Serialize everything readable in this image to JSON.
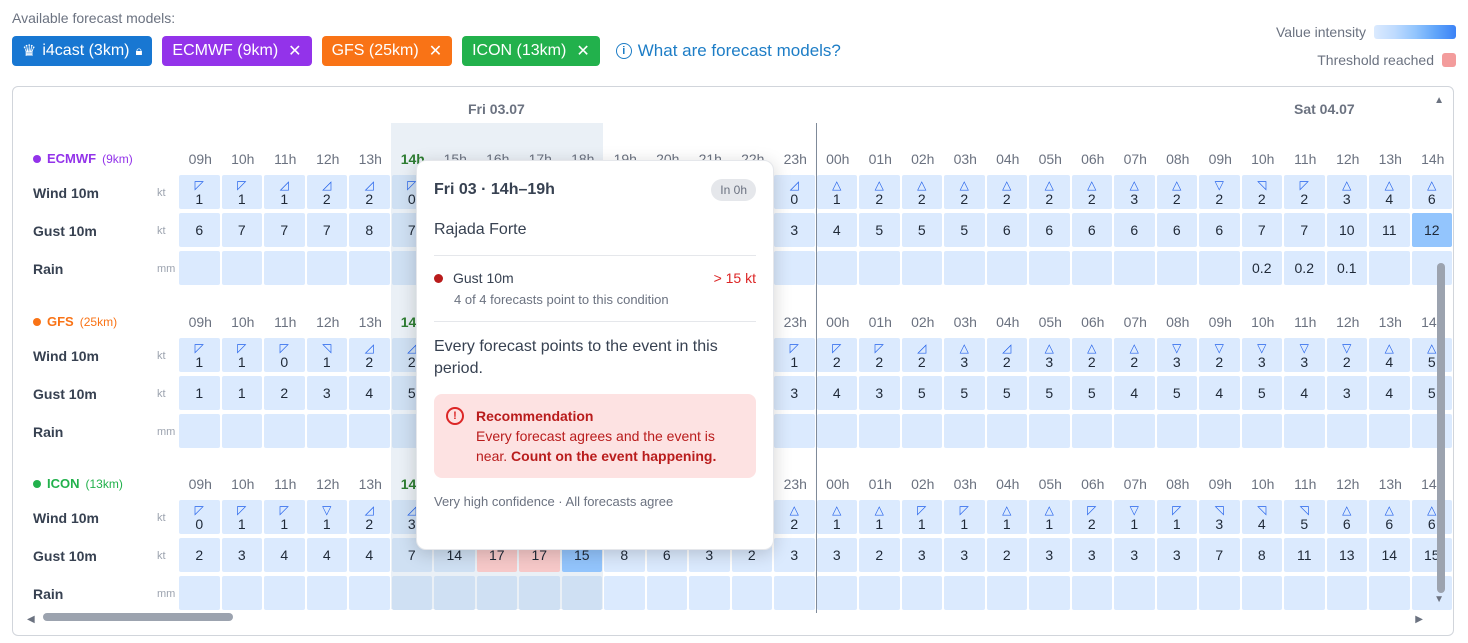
{
  "header": {
    "available_label": "Available forecast models:",
    "info_link": "What are forecast models?",
    "legend_intensity": "Value intensity",
    "legend_threshold": "Threshold reached"
  },
  "chips": [
    {
      "label": "i4cast (3km)",
      "color": "#1877d2",
      "icon": "crown-icon",
      "trail": "lock-icon"
    },
    {
      "label": "ECMWF (9km)",
      "color": "#9333ea",
      "trail": "close-icon"
    },
    {
      "label": "GFS (25km)",
      "color": "#f97316",
      "trail": "close-icon"
    },
    {
      "label": "ICON (13km)",
      "color": "#22b14c",
      "trail": "close-icon"
    }
  ],
  "days": {
    "fri": "Fri 03.07",
    "sat": "Sat 04.07"
  },
  "units": {
    "wind": "kt",
    "gust": "kt",
    "rain": "mm"
  },
  "row_labels": {
    "wind": "Wind 10m",
    "gust": "Gust 10m",
    "rain": "Rain"
  },
  "hours": [
    "09h",
    "10h",
    "11h",
    "12h",
    "13h",
    "14h",
    "15h",
    "16h",
    "17h",
    "18h",
    "19h",
    "20h",
    "21h",
    "22h",
    "23h",
    "00h",
    "01h",
    "02h",
    "03h",
    "04h",
    "05h",
    "06h",
    "07h",
    "08h",
    "09h",
    "10h",
    "11h",
    "12h",
    "13h",
    "14h"
  ],
  "models": [
    {
      "name": "ECMWF",
      "res": "(9km)",
      "color": "#9333ea",
      "wind": [
        "1",
        "1",
        "1",
        "2",
        "2",
        "0",
        "",
        "",
        "",
        "",
        "",
        "",
        "",
        "",
        "0",
        "1",
        "2",
        "2",
        "2",
        "2",
        "2",
        "2",
        "3",
        "2",
        "2",
        "2",
        "2",
        "3",
        "4",
        "6"
      ],
      "wind_arrows": [
        "◸",
        "◸",
        "◿",
        "◿",
        "◿",
        "◸",
        "",
        "",
        "",
        "",
        "",
        "",
        "",
        "",
        "◿",
        "△",
        "△",
        "△",
        "△",
        "△",
        "△",
        "△",
        "△",
        "△",
        "▽",
        "◹",
        "◸",
        "△",
        "△",
        "△"
      ],
      "gust": [
        "6",
        "7",
        "7",
        "7",
        "8",
        "7",
        "",
        "",
        "",
        "",
        "",
        "",
        "",
        "",
        "3",
        "4",
        "5",
        "5",
        "5",
        "6",
        "6",
        "6",
        "6",
        "6",
        "6",
        "7",
        "7",
        "10",
        "11",
        "12"
      ],
      "rain": [
        "",
        "",
        "",
        "",
        "",
        "",
        "",
        "",
        "",
        "",
        "",
        "",
        "",
        "",
        "",
        "",
        "",
        "",
        "",
        "",
        "",
        "",
        "",
        "",
        "",
        "0.2",
        "0.2",
        "0.1",
        "",
        ""
      ]
    },
    {
      "name": "GFS",
      "res": "(25km)",
      "color": "#f97316",
      "wind": [
        "1",
        "1",
        "0",
        "1",
        "2",
        "2",
        "",
        "",
        "",
        "",
        "",
        "",
        "",
        "",
        "1",
        "2",
        "2",
        "2",
        "3",
        "2",
        "3",
        "2",
        "2",
        "3",
        "2",
        "3",
        "3",
        "2",
        "4",
        "5"
      ],
      "wind_arrows": [
        "◸",
        "◸",
        "◸",
        "◹",
        "◿",
        "◿",
        "",
        "",
        "",
        "",
        "",
        "",
        "",
        "",
        "◸",
        "◸",
        "◸",
        "◿",
        "△",
        "◿",
        "△",
        "△",
        "△",
        "▽",
        "▽",
        "▽",
        "▽",
        "▽",
        "△",
        "△"
      ],
      "gust": [
        "1",
        "1",
        "2",
        "3",
        "4",
        "5",
        "",
        "",
        "",
        "",
        "",
        "",
        "",
        "",
        "3",
        "4",
        "3",
        "5",
        "5",
        "5",
        "5",
        "5",
        "4",
        "5",
        "4",
        "5",
        "4",
        "3",
        "4",
        "5"
      ],
      "rain": [
        "",
        "",
        "",
        "",
        "",
        "",
        "",
        "",
        "",
        "",
        "",
        "",
        "",
        "",
        "",
        "",
        "",
        "",
        "",
        "",
        "",
        "",
        "",
        "",
        "",
        "",
        "",
        "",
        "",
        ""
      ]
    },
    {
      "name": "ICON",
      "res": "(13km)",
      "color": "#22b14c",
      "wind": [
        "0",
        "1",
        "1",
        "1",
        "2",
        "3",
        "",
        "",
        "",
        "",
        "",
        "",
        "",
        "",
        "2",
        "1",
        "1",
        "1",
        "1",
        "1",
        "1",
        "2",
        "1",
        "1",
        "3",
        "4",
        "5",
        "6",
        "6",
        "6"
      ],
      "wind_arrows": [
        "◸",
        "◸",
        "◸",
        "▽",
        "◿",
        "◿",
        "",
        "",
        "",
        "",
        "",
        "",
        "",
        "",
        "△",
        "△",
        "△",
        "◸",
        "◸",
        "△",
        "△",
        "◸",
        "▽",
        "◸",
        "◹",
        "◹",
        "◹",
        "△",
        "△",
        "△"
      ],
      "gust": [
        "2",
        "3",
        "4",
        "4",
        "4",
        "7",
        "14",
        "17",
        "17",
        "15",
        "8",
        "6",
        "3",
        "2",
        "3",
        "3",
        "2",
        "3",
        "3",
        "2",
        "3",
        "3",
        "3",
        "3",
        "7",
        "8",
        "11",
        "13",
        "14",
        "15"
      ],
      "rain": [
        "",
        "",
        "",
        "",
        "",
        "",
        "",
        "",
        "",
        "",
        "",
        "",
        "",
        "",
        "",
        "",
        "",
        "",
        "",
        "",
        "",
        "",
        "",
        "",
        "",
        "",
        "",
        "",
        "",
        ""
      ]
    }
  ],
  "tooltip": {
    "title": "Fri 03 · 14h–19h",
    "badge": "In 0h",
    "location": "Rajada Forte",
    "condition": "Gust 10m",
    "threshold": "> 15 kt",
    "condition_sub": "4 of 4 forecasts point to this condition",
    "body": "Every forecast points to the event in this period.",
    "rec_title": "Recommendation",
    "rec_text": "Every forecast agrees and the event is near.",
    "rec_bold": "Count on the event happening.",
    "footer": "Very high confidence · All forecasts agree"
  }
}
